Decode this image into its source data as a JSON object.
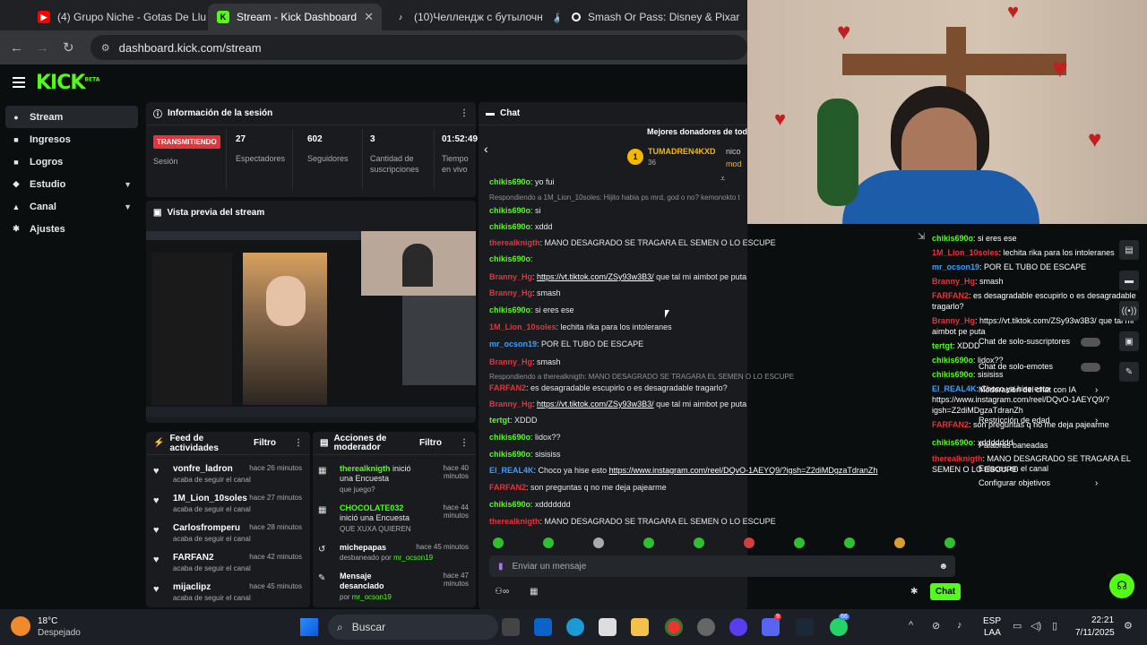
{
  "browser": {
    "tabs": [
      {
        "title": "(4) Grupo Niche - Gotas De Llu",
        "icon": "youtube-icon",
        "color": "#ff0000"
      },
      {
        "title": "Stream - Kick Dashboard",
        "icon": "kick-icon",
        "color": "#53fc18"
      },
      {
        "title": "(10)Челлендж с бутылочн",
        "icon": "tiktok-icon",
        "color": "#ffffff"
      },
      {
        "title": "Smash Or Pass: Disney & Pixar",
        "icon": "search-icon",
        "color": "#ffffff"
      }
    ],
    "url": "dashboard.kick.com/stream"
  },
  "kick": {
    "logo": "KICK",
    "beta": "BETA"
  },
  "sidebar": {
    "items": [
      {
        "label": "Stream",
        "icon": "video-icon"
      },
      {
        "label": "Ingresos",
        "icon": "money-icon"
      },
      {
        "label": "Logros",
        "icon": "trophy-icon"
      },
      {
        "label": "Estudio",
        "icon": "studio-icon"
      },
      {
        "label": "Canal",
        "icon": "channel-icon"
      },
      {
        "label": "Ajustes",
        "icon": "gear-icon"
      }
    ]
  },
  "session": {
    "title": "Información de la sesión",
    "status": "TRANSMITIENDO",
    "status_label": "Sesión",
    "viewers": "27",
    "viewers_label": "Espectadores",
    "followers": "602",
    "followers_label": "Seguidores",
    "subs": "3",
    "subs_label": "Cantidad de suscripciones",
    "time": "01:52:49",
    "time_label": "Tiempo en vivo"
  },
  "preview": {
    "title": "Vista previa del stream"
  },
  "feed": {
    "title": "Feed de actividades",
    "filter": "Filtro",
    "items": [
      {
        "name": "vonfre_ladron",
        "sub": "acaba de seguir el canal",
        "time": "hace 26 minutos"
      },
      {
        "name": "1M_Lion_10soles",
        "sub": "acaba de seguir el canal",
        "time": "hace 27 minutos"
      },
      {
        "name": "Carlosfromperu",
        "sub": "acaba de seguir el canal",
        "time": "hace 28 minutos"
      },
      {
        "name": "FARFAN2",
        "sub": "acaba de seguir el canal",
        "time": "hace 42 minutos"
      },
      {
        "name": "mijaclipz",
        "sub": "acaba de seguir el canal",
        "time": "hace 45 minutos"
      }
    ]
  },
  "mod": {
    "title": "Acciones de moderador",
    "filter": "Filtro",
    "items": [
      {
        "name": "therealknigth",
        "action": "inició una Encuesta",
        "sub": "que juego?",
        "time": "hace 40 minutos"
      },
      {
        "name": "CHOCOLATE032",
        "action": "inició una Encuesta",
        "sub": "QUE XUXA QUIEREN",
        "time": "hace 44 minutos"
      },
      {
        "name": "michepapas",
        "action": "",
        "sub": "desbaneado por",
        "by": "mr_ocson19",
        "time": "hace 45 minutos"
      },
      {
        "name": "Mensaje desanclado",
        "action": "",
        "sub": "por",
        "by": "mr_ocson19",
        "time": "hace 47 minutos"
      }
    ]
  },
  "chat": {
    "title": "Chat",
    "top_donors": "Mejores donadores de tod",
    "donor_name": "TUMADREN4KXD",
    "donor_amount": "36",
    "donor_2": "nico",
    "donor_3": "mod",
    "messages": [
      {
        "user": "chikis690o",
        "color": "#53fc18",
        "text": "yo fui"
      },
      {
        "reply": "Respondiendo a 1M_Lion_10soles: Hijito habia ps mrd, god o no? kemonokto t"
      },
      {
        "user": "chikis690o",
        "color": "#53fc18",
        "text": "si"
      },
      {
        "user": "chikis690o",
        "color": "#53fc18",
        "text": "xddd"
      },
      {
        "user": "therealknigth",
        "color": "#e5343a",
        "text": "MANO DESAGRADO SE TRAGARA EL SEMEN O LO ESCUPE"
      },
      {
        "user": "chikis690o",
        "color": "#53fc18",
        "text": ""
      },
      {
        "user": "Branny_Hg",
        "color": "#e5343a",
        "link": "https://vt.tiktok.com/ZSy93w3B3/",
        "text": "que tal mi aimbot pe puta"
      },
      {
        "user": "Branny_Hg",
        "color": "#e5343a",
        "text": "smash"
      },
      {
        "user": "chikis690o",
        "color": "#53fc18",
        "text": "si eres ese"
      },
      {
        "user": "1M_Lion_10soles",
        "color": "#e5343a",
        "text": "lechita rika para los intoleranes"
      },
      {
        "user": "mr_ocson19",
        "color": "#3aa0ff",
        "text": "POR EL TUBO DE ESCAPE"
      },
      {
        "user": "Branny_Hg",
        "color": "#e5343a",
        "text": "smash"
      },
      {
        "reply": "Respondiendo a therealknigth: MANO DESAGRADO SE TRAGARA EL SEMEN O LO ESCUPE"
      },
      {
        "user": "FARFAN2",
        "color": "#e5343a",
        "text": "es desagradable escupirlo o es desagradable tragarlo?"
      },
      {
        "user": "Branny_Hg",
        "color": "#e5343a",
        "link": "https://vt.tiktok.com/ZSy93w3B3/",
        "text": "que tal mi aimbot pe puta"
      },
      {
        "user": "tertgt",
        "color": "#53fc18",
        "text": "XDDD"
      },
      {
        "user": "chikis690o",
        "color": "#53fc18",
        "text": "lidox??"
      },
      {
        "user": "chikis690o",
        "color": "#53fc18",
        "text": "sisisiss"
      },
      {
        "user": "El_REAL4K",
        "color": "#3aa0ff",
        "link2_pre": "Choco ya hise esto ",
        "link": "https://www.instagram.com/reel/DQvO-1AEYQ9/?igsh=Z2diMDgzaTdranZh",
        "text": ""
      },
      {
        "user": "FARFAN2",
        "color": "#e5343a",
        "text": "son preguntas q no me deja pajearme"
      },
      {
        "user": "chikis690o",
        "color": "#53fc18",
        "text": "xddddddd"
      },
      {
        "user": "therealknigth",
        "color": "#e5343a",
        "text": "MANO DESAGRADO SE TRAGARA EL SEMEN O LO ESCUPE"
      }
    ],
    "input_placeholder": "Enviar un mensaje",
    "send_label": "Chat"
  },
  "overlay": {
    "lines": [
      {
        "user": "chikis690o",
        "text": "si eres ese"
      },
      {
        "user": "1M_Lion_10soles",
        "text": "lechita rika para los intoleranes"
      },
      {
        "user": "mr_ocson19",
        "text": "POR EL TUBO DE ESCAPE"
      },
      {
        "user": "Branny_Hg",
        "text": "smash"
      },
      {
        "user": "FARFAN2",
        "text": "es desagradable escupirlo o es desagradable tragarlo?"
      },
      {
        "user": "Branny_Hg",
        "text": "https://vt.tiktok.com/ZSy93w3B3/ que tal mi aimbot pe puta"
      },
      {
        "user": "tertgt",
        "text": "XDDD"
      },
      {
        "user": "chikis690o",
        "text": "lidox??"
      },
      {
        "user": "chikis690o",
        "text": "sisisiss"
      },
      {
        "user": "El_REAL4K",
        "text": "Choco ya hise esto https://www.instagram.com/reel/DQvO-1AEYQ9/?igsh=Z2diMDgzaTdranZh"
      },
      {
        "user": "FARFAN2",
        "text": "son preguntas q no me deja pajearme"
      },
      {
        "user": "chikis690o",
        "text": "xddddddd"
      },
      {
        "user": "therealknigth",
        "text": "MANO DESAGRADO SE TRAGARA EL SEMEN O LO ESCUPE"
      }
    ],
    "menu": [
      "Chat de solo-suscriptores",
      "Chat de solo-emotes",
      "Moderación del chat con IA",
      "Restricción de edad",
      "Palabras baneadas",
      "Enlaces en el canal",
      "Configurar objetivos"
    ]
  },
  "taskbar": {
    "weather_temp": "18°C",
    "weather_desc": "Despejado",
    "search": "Buscar",
    "lang": "ESP",
    "lang2": "LAA",
    "time": "22:21",
    "date": "7/11/2025",
    "badge_discord": "9",
    "badge_whatsapp": "66"
  }
}
